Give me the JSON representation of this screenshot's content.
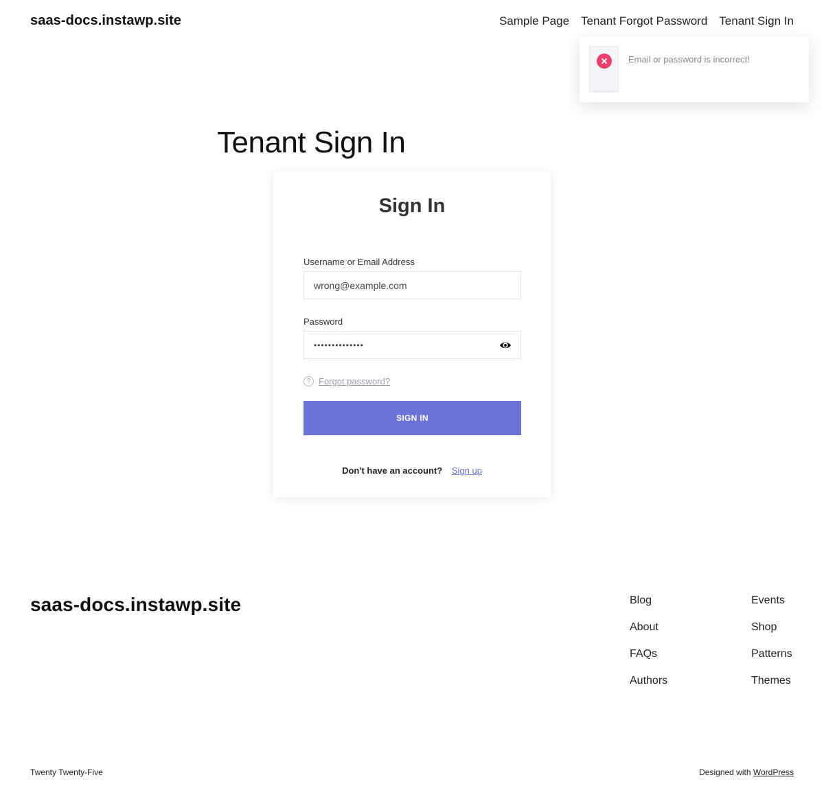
{
  "header": {
    "site_title": "saas-docs.instawp.site",
    "nav": [
      "Sample Page",
      "Tenant Forgot Password",
      "Tenant Sign In"
    ]
  },
  "toast": {
    "icon": "error-x-icon",
    "message": "Email or password is incorrect!",
    "color": "#f03c6a"
  },
  "page": {
    "title": "Tenant Sign In"
  },
  "form": {
    "heading": "Sign In",
    "username_label": "Username or Email Address",
    "username_value": "wrong@example.com",
    "password_label": "Password",
    "password_value": "••••••••••••••",
    "forgot_label": "Forgot password?",
    "submit_label": "SIGN IN",
    "no_account_text": "Don't have an account?",
    "signup_label": "Sign up",
    "accent_color": "#6b72d8"
  },
  "footer": {
    "site_title": "saas-docs.instawp.site",
    "col1": [
      "Blog",
      "About",
      "FAQs",
      "Authors"
    ],
    "col2": [
      "Events",
      "Shop",
      "Patterns",
      "Themes"
    ],
    "theme_credit": "Twenty Twenty-Five",
    "designed_with": "Designed with",
    "wordpress_label": "WordPress"
  }
}
